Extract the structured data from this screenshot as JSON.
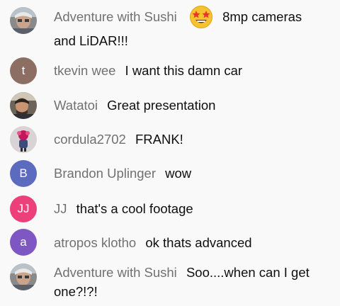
{
  "messages": [
    {
      "author": "Adventure with Sushi",
      "text_line1": "8mp cameras",
      "text_line2": "and LiDAR!!!",
      "emoji": "star-struck-emoji",
      "avatar": {
        "type": "photo",
        "name": "sushi-photo"
      }
    },
    {
      "author": "tkevin wee",
      "text": "I want this damn car",
      "avatar": {
        "type": "initial",
        "letter": "t",
        "color": "#8d6e63"
      }
    },
    {
      "author": "Watatoi",
      "text": "Great presentation",
      "avatar": {
        "type": "photo",
        "name": "watatoi-photo"
      }
    },
    {
      "author": "cordula2702",
      "text": "FRANK!",
      "avatar": {
        "type": "photo",
        "name": "cordula-photo"
      }
    },
    {
      "author": "Brandon Uplinger",
      "text": "wow",
      "avatar": {
        "type": "initial",
        "letter": "B",
        "color": "#5c6bc0"
      }
    },
    {
      "author": "JJ",
      "text": "that's a cool footage",
      "avatar": {
        "type": "initial",
        "letter": "JJ",
        "color": "#ec407a"
      }
    },
    {
      "author": "atropos klotho",
      "text": "ok thats advanced",
      "avatar": {
        "type": "initial",
        "letter": "a",
        "color": "#7e57c2"
      }
    },
    {
      "author": "Adventure with Sushi",
      "text_line1": "Soo....when can I get",
      "text_line2": "one?!?!",
      "avatar": {
        "type": "photo",
        "name": "sushi-photo"
      }
    }
  ]
}
